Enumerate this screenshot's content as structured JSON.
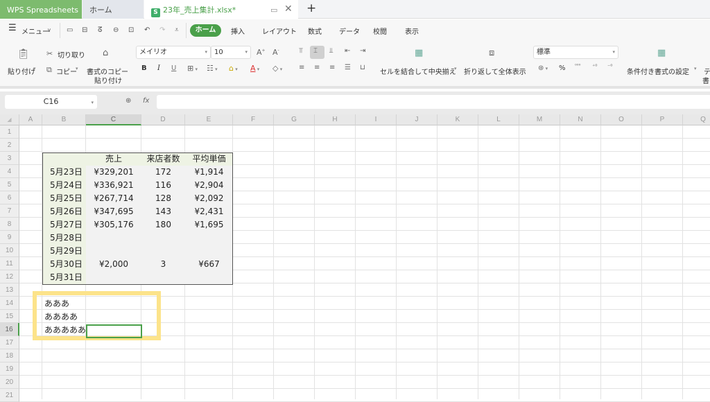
{
  "tabs": {
    "app": "WPS Spreadsheets",
    "home": "ホーム",
    "file": "23年_売上集計.xlsx*",
    "file_icon": "S",
    "add": "+"
  },
  "menubar": {
    "menu_label": "メニュー",
    "ribbon_tabs": [
      "ホーム",
      "挿入",
      "レイアウト",
      "数式",
      "データ",
      "校閲",
      "表示"
    ],
    "active_tab": "ホーム"
  },
  "ribbon": {
    "paste": "貼り付け",
    "cut": "切り取り",
    "copy": "コピー",
    "format_painter_line1": "書式のコピー",
    "format_painter_line2": "貼り付け",
    "font_name": "メイリオ",
    "font_size": "10",
    "merge_center": "セルを結合して中央揃え",
    "wrap_text": "折り返して全体表示",
    "number_format": "標準",
    "conditional_format": "条件付き書式の設定",
    "table_style_partial_line1": "テ",
    "table_style_partial_line2": "書",
    "bold": "B",
    "italic": "I",
    "underline": "U",
    "percent": "%"
  },
  "formula_bar": {
    "name_box": "C16",
    "fx_label": "fx",
    "formula": ""
  },
  "columns": [
    "A",
    "B",
    "C",
    "D",
    "E",
    "F",
    "G",
    "H",
    "I",
    "J",
    "K",
    "L",
    "M",
    "N",
    "O",
    "P",
    "Q"
  ],
  "selected_column": "C",
  "rows": [
    "1",
    "2",
    "3",
    "4",
    "5",
    "6",
    "7",
    "8",
    "9",
    "10",
    "11",
    "12",
    "13",
    "14",
    "15",
    "16",
    "17",
    "18",
    "19",
    "20",
    "21"
  ],
  "selected_row": "16",
  "table": {
    "headers": [
      "",
      "売上",
      "来店者数",
      "平均単価"
    ],
    "rows": [
      {
        "date": "5月23日",
        "sales": "¥329,201",
        "visitors": "172",
        "avg": "¥1,914"
      },
      {
        "date": "5月24日",
        "sales": "¥336,921",
        "visitors": "116",
        "avg": "¥2,904"
      },
      {
        "date": "5月25日",
        "sales": "¥267,714",
        "visitors": "128",
        "avg": "¥2,092"
      },
      {
        "date": "5月26日",
        "sales": "¥347,695",
        "visitors": "143",
        "avg": "¥2,431"
      },
      {
        "date": "5月27日",
        "sales": "¥305,176",
        "visitors": "180",
        "avg": "¥1,695"
      },
      {
        "date": "5月28日",
        "sales": "",
        "visitors": "",
        "avg": ""
      },
      {
        "date": "5月29日",
        "sales": "",
        "visitors": "",
        "avg": ""
      },
      {
        "date": "5月30日",
        "sales": "¥2,000",
        "visitors": "3",
        "avg": "¥667"
      },
      {
        "date": "5月31日",
        "sales": "",
        "visitors": "",
        "avg": ""
      }
    ]
  },
  "extra_cells": {
    "b14": "あああ",
    "b15": "ああああ",
    "b16": "あああああ"
  },
  "colors": {
    "accent": "#4aa04a",
    "highlight_box": "#fce38a",
    "table_header_fill": "#eef3e4"
  }
}
